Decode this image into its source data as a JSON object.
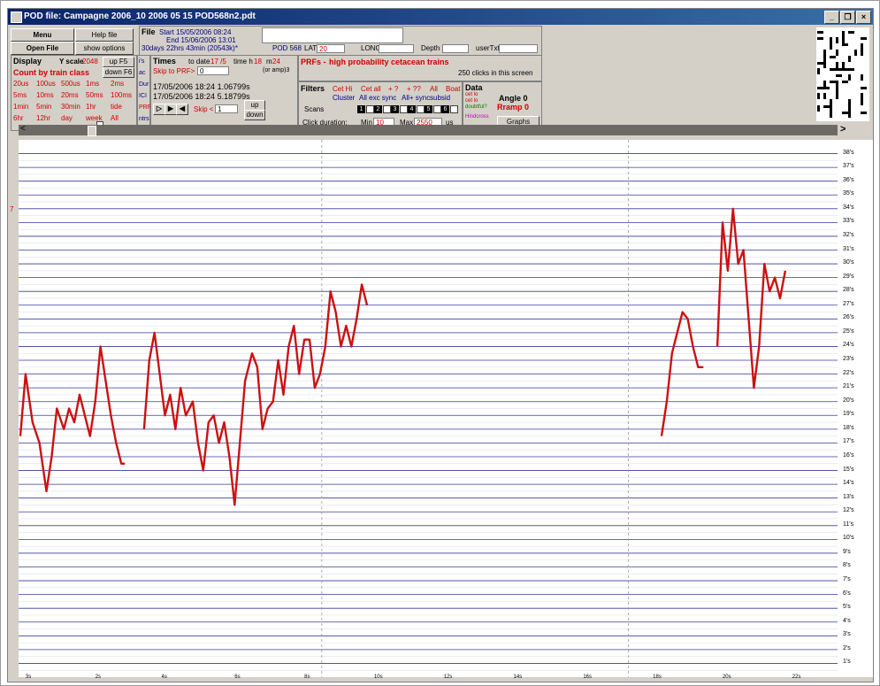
{
  "window": {
    "title": "POD file:  Campagne 2006_10 2006 05 15 POD568n2.pdt"
  },
  "toolbar": {
    "menu_label": "Menu",
    "help_label": "Help file",
    "open_label": "Open File",
    "show_options_label": "show options"
  },
  "display": {
    "label": "Display",
    "yscale_label": "Y scale",
    "yscale_value": "2048",
    "up_label": "up F5",
    "down_label": "down F6",
    "count_label": "Count by train class",
    "bins": [
      "20us",
      "100us",
      "500us",
      "1ms",
      "2ms",
      "5ms",
      "10ms",
      "20ms",
      "50ms",
      "100ms",
      "1min",
      "5min",
      "30min",
      "1hr",
      "tide",
      "6hr",
      "12hr",
      "day",
      "week",
      "All"
    ]
  },
  "side_labels": [
    "i's",
    "ac",
    "Dur",
    "ICI",
    "PRF",
    "ntrs"
  ],
  "file": {
    "label": "File",
    "start": "Start 15/05/2006  08:24",
    "end": "End 15/06/2006  13:01",
    "duration": "30days 22hrs 43min  (20543k)*",
    "pod": "POD 568",
    "lat_label": "LAT",
    "lat_value": "20",
    "long_label": "LONG",
    "depth_label": "Depth",
    "usertxt_label": "userTxt"
  },
  "times": {
    "label": "Times",
    "to_date_label": "to date",
    "to_date_value": "17 /5",
    "time_h_label": "time h",
    "time_h_value": "18",
    "m_label": "m",
    "m_value": "24",
    "skip_prf_label": "Skip to PRF>",
    "skip_prf_value": "0",
    "jump_label": "(or amp)3",
    "line1": "17/05/2006  18:24  1.06799s",
    "line2": "17/05/2006  18:24  5.18799s",
    "skip_label": "Skip <",
    "skip_value": "1",
    "up_label": "up",
    "down_label": "down"
  },
  "prf": {
    "label": "PRFs -",
    "desc": "high probability cetacean trains",
    "clicks": "250 clicks in this screen"
  },
  "filters": {
    "label": "Filters",
    "opts": [
      "Cet Hi",
      "Cet all",
      "+ ?",
      "+ ??",
      "All",
      "Boat"
    ],
    "cluster_row": [
      "Cluster",
      "All exc sync",
      "All+ sync",
      "subsid"
    ],
    "scans_label": "Scans",
    "scans": [
      "1",
      "2",
      "3",
      "4",
      "5",
      "6"
    ],
    "click_duration_label": "Click duration:",
    "min_label": "Min",
    "min_value": "10",
    "max_label": "Max",
    "max_value": "2550",
    "us_label": "us"
  },
  "data": {
    "label": "Data",
    "r1": "cet lo",
    "r2": "cet lo",
    "r3": "doubtful?",
    "r4": "Hindcross",
    "angle_label": "Angle 0",
    "ramp_label": "Rramp 0",
    "graphs_label": "Graphs"
  },
  "scroll": {
    "left_arrow": "<",
    "right_arrow": ">"
  },
  "left_marker": "7",
  "chart_data": {
    "type": "line",
    "y_labels": [
      "38's",
      "37's",
      "36's",
      "35's",
      "34's",
      "33's",
      "32's",
      "31's",
      "30's",
      "29's",
      "28's",
      "27's",
      "26's",
      "25's",
      "24's",
      "23's",
      "22's",
      "21's",
      "20's",
      "19's",
      "18's",
      "17's",
      "16's",
      "15's",
      "14's",
      "13's",
      "12's",
      "11's",
      "10's",
      "9's",
      "8's",
      "7's",
      "6's",
      "5's",
      "4's",
      "3's",
      "2's",
      "1's"
    ],
    "x_labels": [
      "3s",
      "2s",
      "4s",
      "6s",
      "8s",
      "10s",
      "12s",
      "14s",
      "16s",
      "18s",
      "20s",
      "22s"
    ],
    "ylim": [
      0,
      39
    ],
    "xlim": [
      0,
      23.5
    ],
    "line_color": "#cc1111",
    "series": [
      {
        "x": [
          0.05,
          0.2,
          0.4,
          0.6,
          0.8,
          0.95,
          1.1,
          1.3,
          1.45,
          1.6,
          1.75,
          1.9,
          2.05,
          2.2,
          2.35,
          2.5,
          2.65,
          2.8,
          2.95,
          3.05
        ],
        "y": [
          17.5,
          22,
          18.5,
          17,
          13.5,
          16,
          19.5,
          18,
          19.5,
          18.5,
          20.5,
          19,
          17.5,
          20,
          24,
          21.5,
          19,
          17,
          15.5,
          15.5
        ]
      },
      {
        "x": [
          3.6,
          3.75,
          3.9,
          4.05,
          4.2,
          4.35,
          4.5,
          4.65,
          4.8,
          5.0,
          5.15,
          5.3,
          5.45,
          5.6,
          5.75,
          5.9,
          6.05,
          6.2,
          6.35,
          6.5,
          6.7,
          6.85,
          7.0,
          7.15,
          7.3,
          7.45,
          7.6,
          7.75,
          7.9,
          8.05,
          8.2,
          8.35,
          8.5,
          8.65,
          8.8,
          8.95,
          9.1,
          9.25,
          9.4,
          9.55,
          9.7,
          9.85,
          10.0
        ],
        "y": [
          18,
          23,
          25,
          22,
          19,
          20.5,
          18,
          21,
          19,
          20,
          17,
          15,
          18.5,
          19,
          17,
          18.5,
          16,
          12.5,
          17,
          21.5,
          23.5,
          22.5,
          18,
          19.5,
          20,
          23,
          20.5,
          24,
          25.5,
          22,
          24.5,
          24.5,
          21,
          22,
          24,
          28,
          26.5,
          24,
          25.5,
          24,
          26,
          28.5,
          27
        ]
      },
      {
        "x": [
          18.45,
          18.6,
          18.75,
          18.9,
          19.05,
          19.2,
          19.35,
          19.5,
          19.65
        ],
        "y": [
          17.5,
          20,
          23.5,
          25,
          26.5,
          26,
          24,
          22.5,
          22.5
        ]
      },
      {
        "x": [
          20.05,
          20.2,
          20.35,
          20.5,
          20.65,
          20.8,
          20.95,
          21.1,
          21.25,
          21.4,
          21.55,
          21.7,
          21.85,
          22.0
        ],
        "y": [
          24,
          33,
          29.5,
          34,
          30,
          31,
          26,
          21,
          24,
          30,
          28,
          29,
          27.5,
          29.5
        ]
      }
    ]
  }
}
